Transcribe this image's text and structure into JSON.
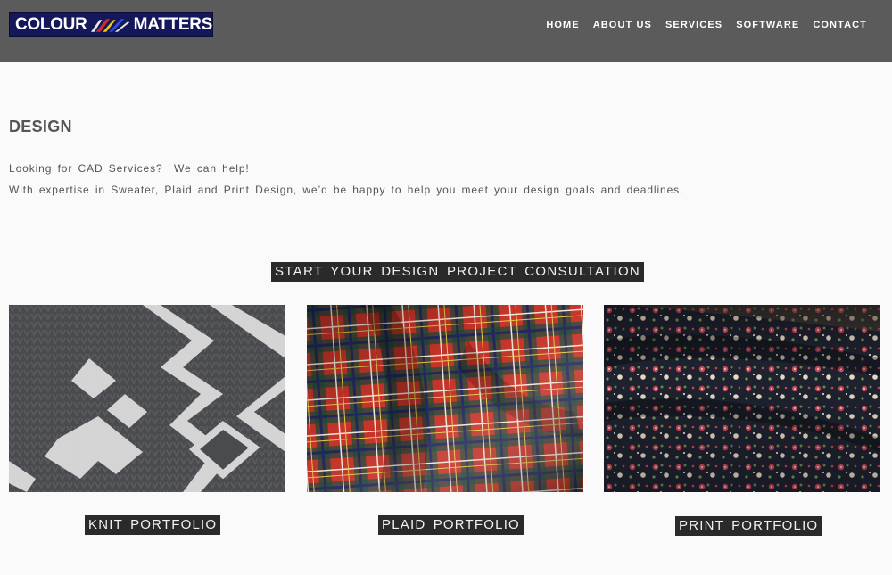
{
  "header": {
    "logo": {
      "text_left": "COLOUR",
      "text_right": "MATTERS"
    },
    "nav": [
      {
        "label": "HOME"
      },
      {
        "label": "ABOUT US"
      },
      {
        "label": "SERVICES"
      },
      {
        "label": "SOFTWARE"
      },
      {
        "label": "CONTACT"
      }
    ]
  },
  "main": {
    "title": "DESIGN",
    "intro_line1": "Looking for CAD Services?  We can help!",
    "intro_line2": "With expertise in Sweater, Plaid and Print Design, we’d be happy to help you meet your design goals and deadlines.",
    "cta_label": "START YOUR DESIGN PROJECT CONSULTATION",
    "portfolios": [
      {
        "label": "KNIT PORTFOLIO",
        "image": "knit-sweater-image"
      },
      {
        "label": "PLAID PORTFOLIO",
        "image": "plaid-fabric-image"
      },
      {
        "label": "PRINT PORTFOLIO",
        "image": "floral-print-image"
      }
    ]
  },
  "colors": {
    "header_bg": "#5b5b5b",
    "logo_bg": "#14185a",
    "button_bg": "#2a2a2a",
    "page_bg": "#fafafa"
  }
}
